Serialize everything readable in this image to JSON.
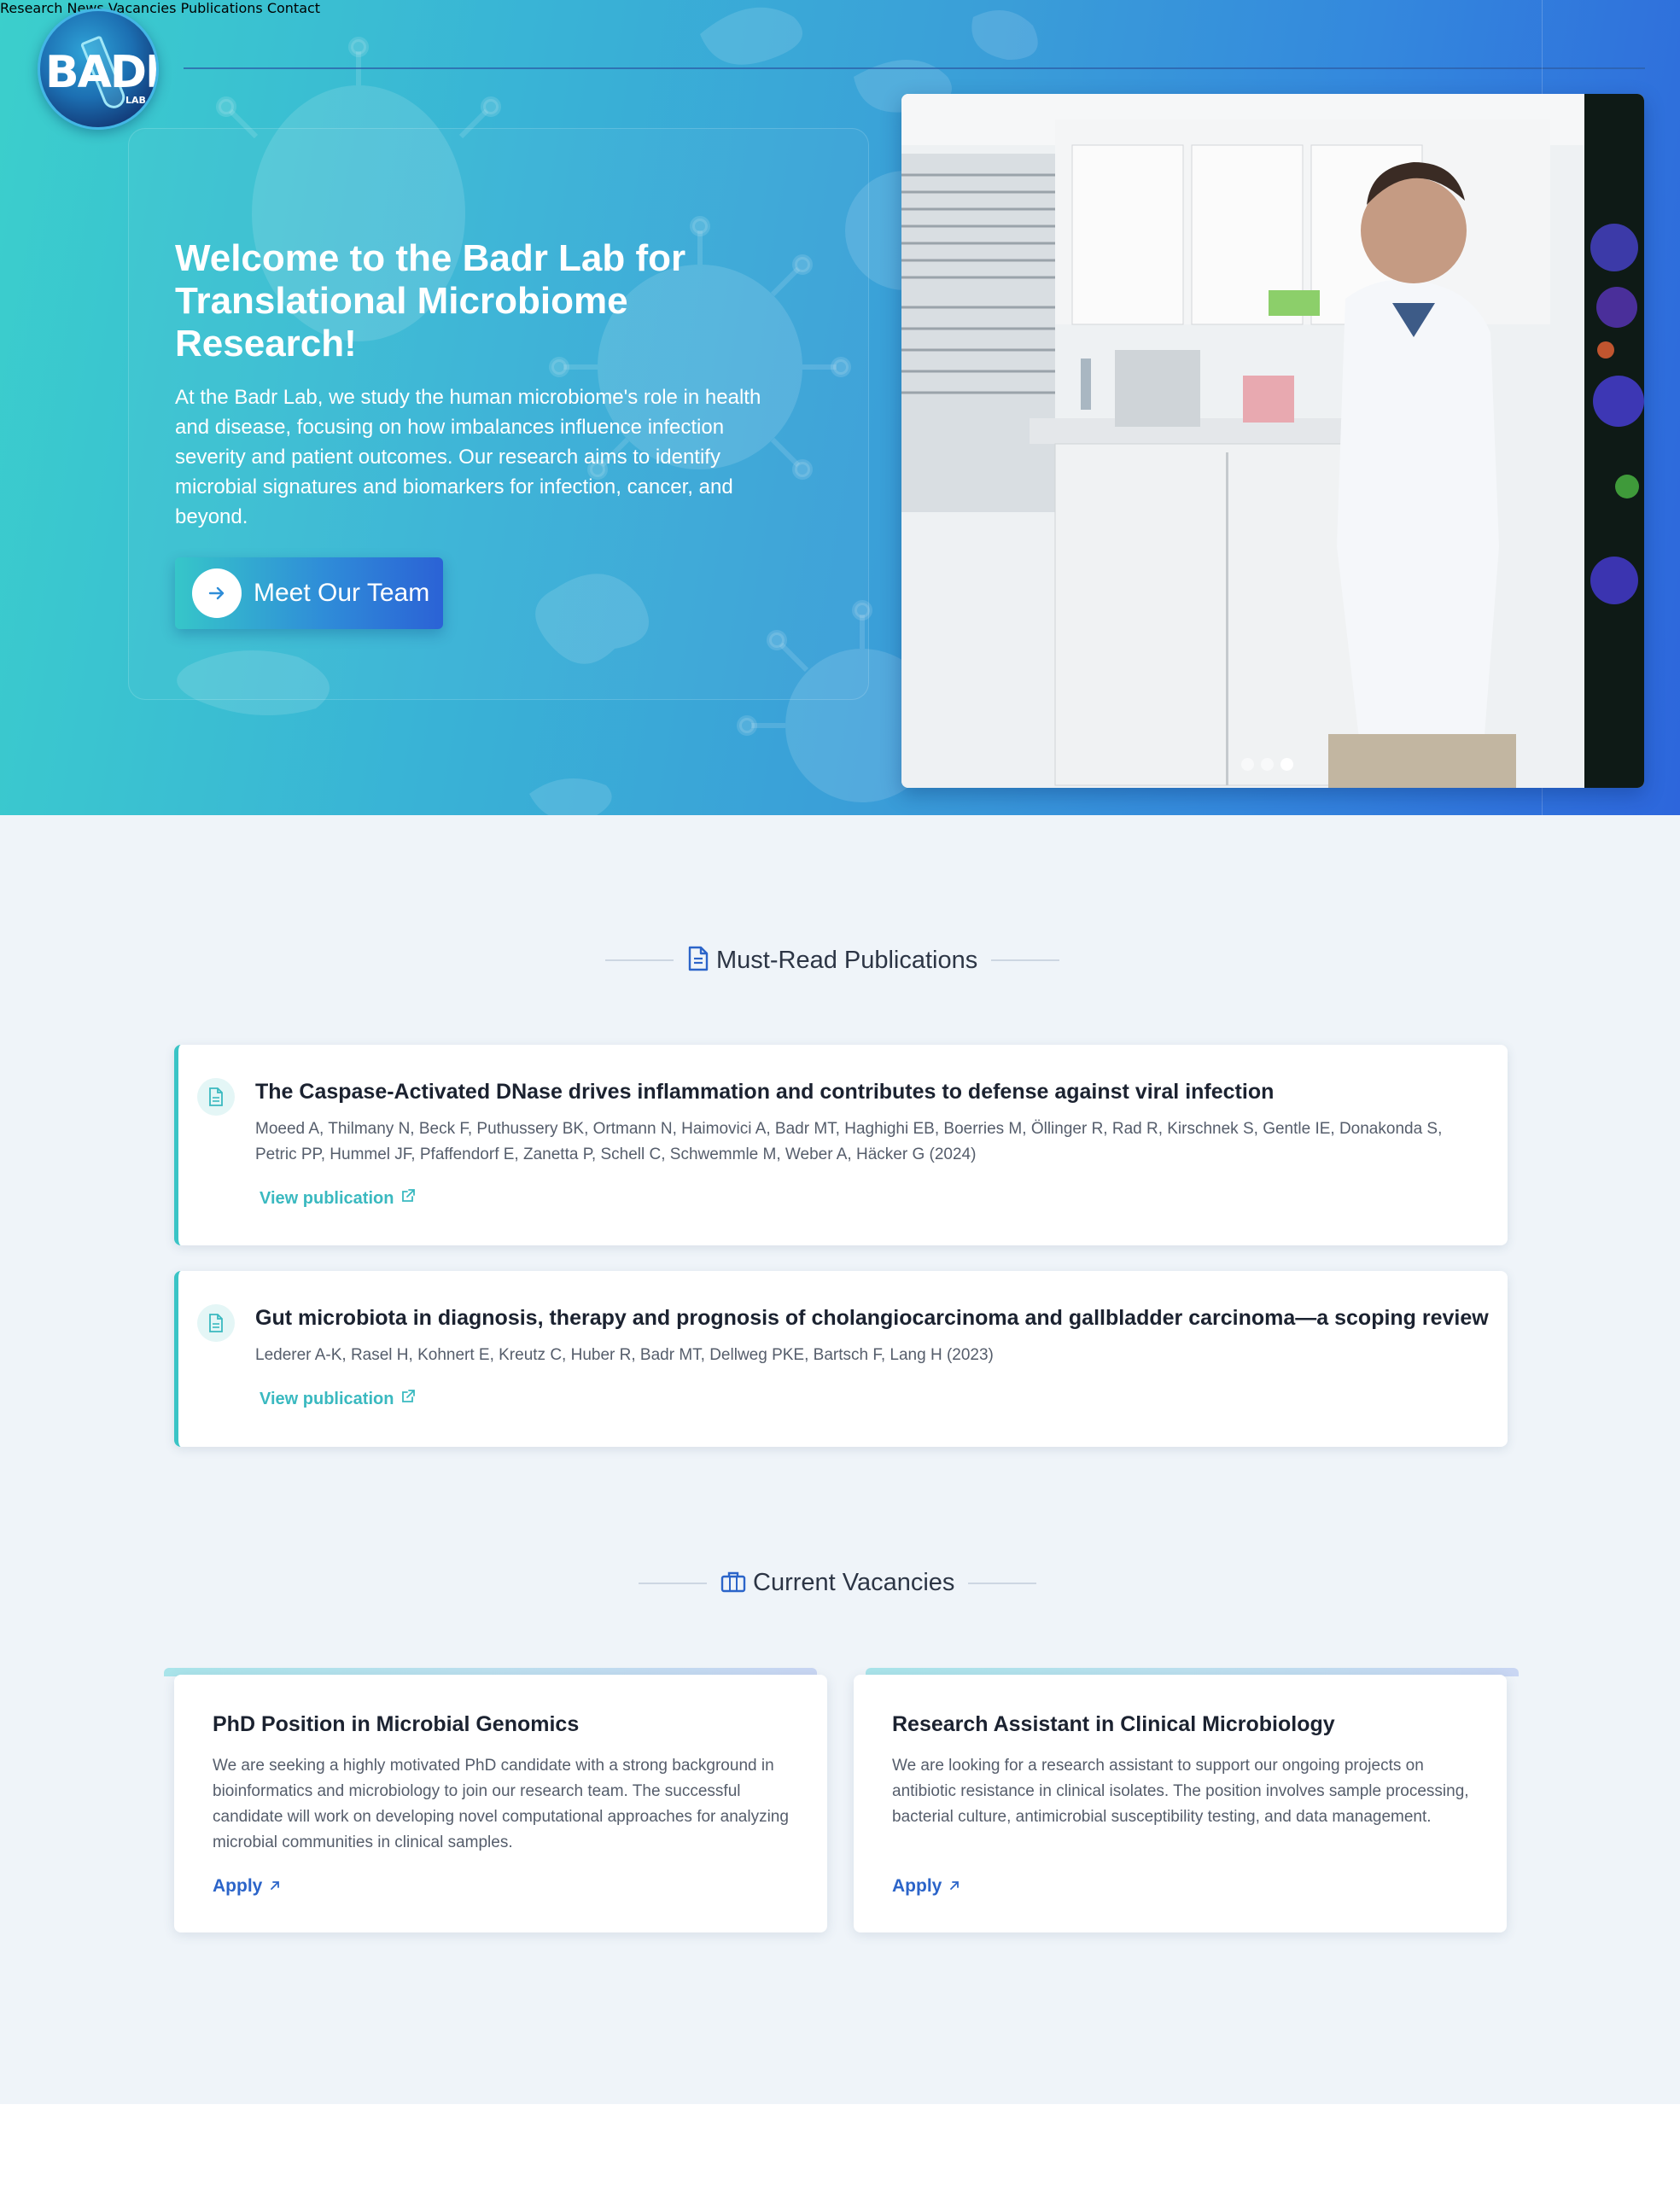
{
  "logo": {
    "text": "BADR",
    "sub": "LAB"
  },
  "nav": {
    "items": [
      "Research",
      "News",
      "Vacancies",
      "Publications",
      "Contact"
    ]
  },
  "hero": {
    "title": "Welcome to the Badr Lab for Translational Microbiome Research!",
    "description": "At the Badr Lab, we study the human microbiome's role in health and disease, focusing on how imbalances influence infection severity and patient outcomes. Our research aims to identify microbial signatures and biomarkers for infection, cancer, and beyond.",
    "button_label": "Meet Our Team",
    "carousel": {
      "total": 3,
      "active_index": 2
    }
  },
  "publications": {
    "heading": "Must-Read Publications",
    "items": [
      {
        "title": "The Caspase-Activated DNase drives inflammation and contributes to defense against viral infection",
        "authors": "Moeed A, Thilmany N, Beck F, Puthussery BK, Ortmann N, Haimovici A, Badr MT, Haghighi EB, Boerries M, Öllinger R, Rad R, Kirschnek S, Gentle IE, Donakonda S, Petric PP, Hummel JF, Pfaffendorf E, Zanetta P, Schell C, Schwemmle M, Weber A, Häcker G (2024)",
        "link_label": "View publication"
      },
      {
        "title": "Gut microbiota in diagnosis, therapy and prognosis of cholangiocarcinoma and gallbladder carcinoma—a scoping review",
        "authors": "Lederer A-K, Rasel H, Kohnert E, Kreutz C, Huber R, Badr MT, Dellweg PKE, Bartsch F, Lang H (2023)",
        "link_label": "View publication"
      }
    ]
  },
  "vacancies": {
    "heading": "Current Vacancies",
    "items": [
      {
        "title": "PhD Position in Microbial Genomics",
        "description": "We are seeking a highly motivated PhD candidate with a strong background in bioinformatics and microbiology to join our research team. The successful candidate will work on developing novel computational approaches for analyzing microbial communities in clinical samples.",
        "apply_label": "Apply"
      },
      {
        "title": "Research Assistant in Clinical Microbiology",
        "description": "We are looking for a research assistant to support our ongoing projects on antibiotic resistance in clinical isolates. The position involves sample processing, bacterial culture, antimicrobial susceptibility testing, and data management.",
        "apply_label": "Apply"
      }
    ]
  },
  "colors": {
    "hero_start": "#3bcfcc",
    "hero_end": "#2d66dc",
    "accent_teal": "#3ac4c6",
    "accent_blue": "#2b64c9",
    "section_bg": "#eff4f9"
  },
  "icons": {
    "button": "arrow-right-icon",
    "publications": "document-icon",
    "vacancies": "briefcase-icon",
    "pub_link": "external-link-icon",
    "apply": "arrow-up-right-icon"
  }
}
